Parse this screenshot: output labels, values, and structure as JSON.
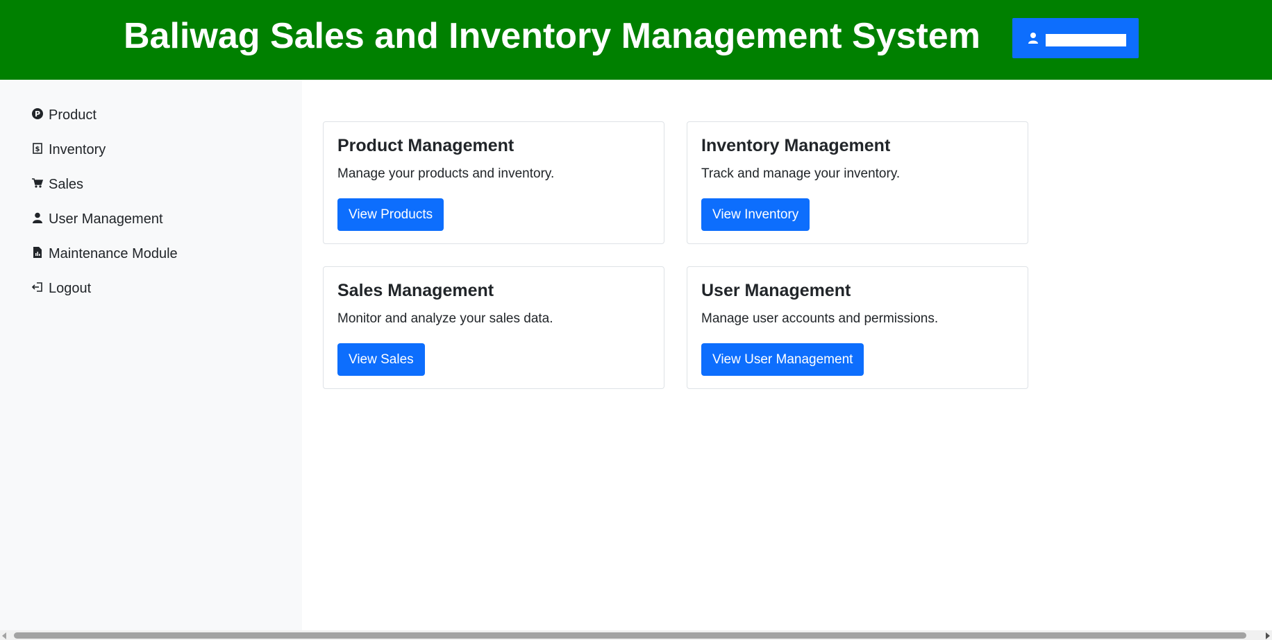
{
  "header": {
    "title": "Baliwag Sales and Inventory Management System",
    "user_button_icon": "user-icon",
    "colors": {
      "background": "#008000",
      "user_button": "#0d6efd"
    }
  },
  "sidebar": {
    "items": [
      {
        "label": "Product",
        "icon": "product-p-icon"
      },
      {
        "label": "Inventory",
        "icon": "inventory-receipt-icon"
      },
      {
        "label": "Sales",
        "icon": "cart-icon"
      },
      {
        "label": "User Management",
        "icon": "person-icon"
      },
      {
        "label": "Maintenance Module",
        "icon": "file-chart-icon"
      },
      {
        "label": "Logout",
        "icon": "logout-icon"
      }
    ]
  },
  "cards": [
    {
      "title": "Product Management",
      "text": "Manage your products and inventory.",
      "button": "View Products"
    },
    {
      "title": "Inventory Management",
      "text": "Track and manage your inventory.",
      "button": "View Inventory"
    },
    {
      "title": "Sales Management",
      "text": "Monitor and analyze your sales data.",
      "button": "View Sales"
    },
    {
      "title": "User Management",
      "text": "Manage user accounts and permissions.",
      "button": "View User Management"
    }
  ]
}
